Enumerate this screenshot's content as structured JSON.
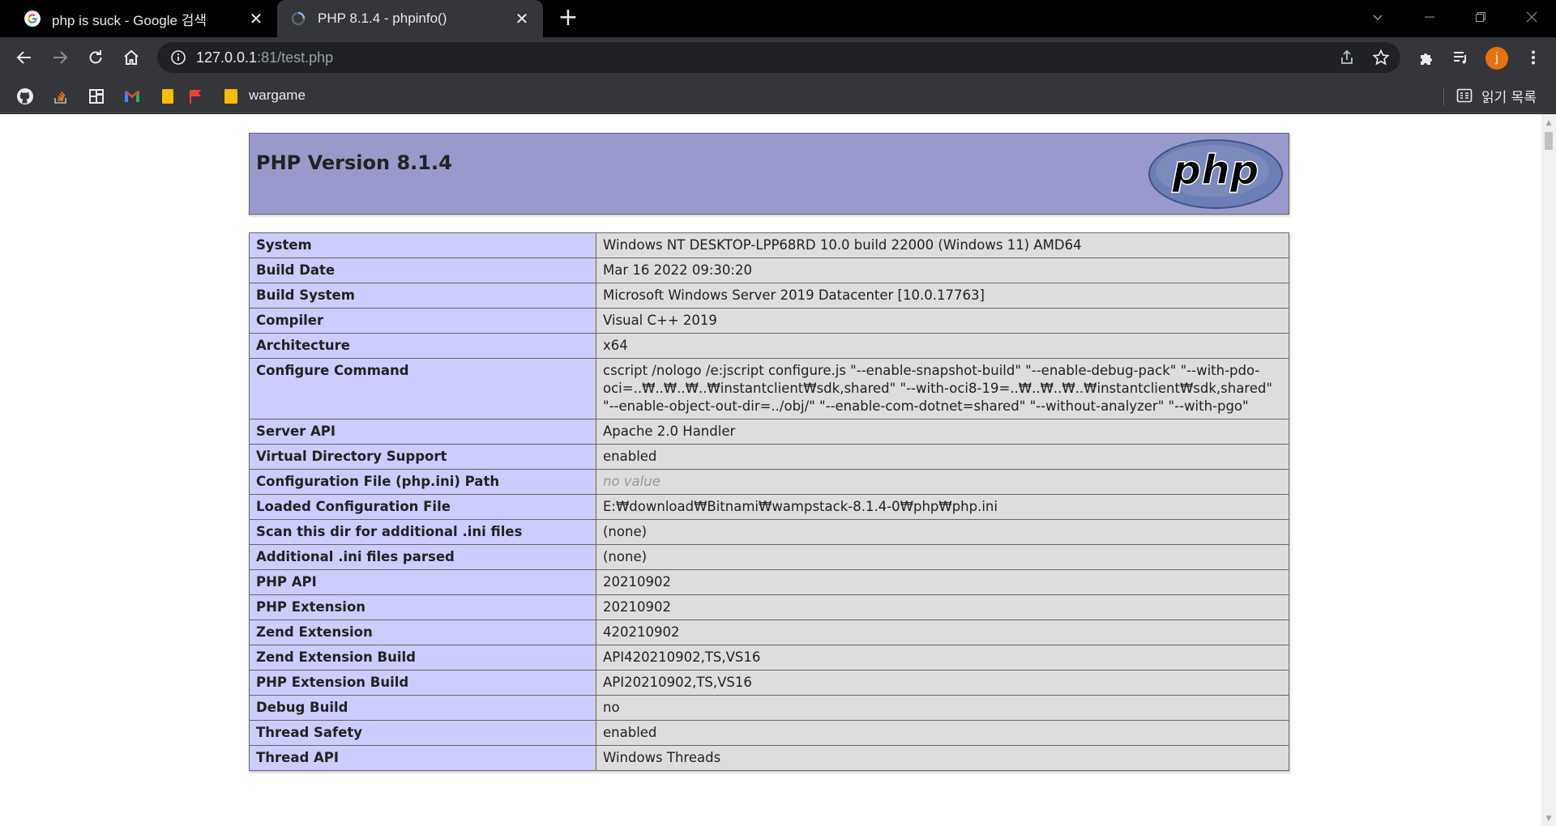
{
  "tabs": [
    {
      "title": "php is suck - Google 검색",
      "icon": "google-icon"
    },
    {
      "title": "PHP 8.1.4 - phpinfo()",
      "icon": "loading-icon"
    }
  ],
  "omnibox": {
    "host": "127.0.0.1",
    "rest": ":81/test.php"
  },
  "profile": {
    "initial": "j"
  },
  "bookmarks": {
    "folder_label": "wargame",
    "reading_list": "읽기 목록"
  },
  "php": {
    "version_title": "PHP Version 8.1.4",
    "logo_text": "php",
    "rows": [
      {
        "key": "System",
        "value": "Windows NT DESKTOP-LPP68RD 10.0 build 22000 (Windows 11) AMD64"
      },
      {
        "key": "Build Date",
        "value": "Mar 16 2022 09:30:20"
      },
      {
        "key": "Build System",
        "value": "Microsoft Windows Server 2019 Datacenter [10.0.17763]"
      },
      {
        "key": "Compiler",
        "value": "Visual C++ 2019"
      },
      {
        "key": "Architecture",
        "value": "x64"
      },
      {
        "key": "Configure Command",
        "value": "cscript /nologo /e:jscript configure.js \"--enable-snapshot-build\" \"--enable-debug-pack\" \"--with-pdo-oci=..₩..₩..₩..₩instantclient₩sdk,shared\" \"--with-oci8-19=..₩..₩..₩..₩instantclient₩sdk,shared\" \"--enable-object-out-dir=../obj/\" \"--enable-com-dotnet=shared\" \"--without-analyzer\" \"--with-pgo\""
      },
      {
        "key": "Server API",
        "value": "Apache 2.0 Handler"
      },
      {
        "key": "Virtual Directory Support",
        "value": "enabled"
      },
      {
        "key": "Configuration File (php.ini) Path",
        "value": "no value",
        "novalue": true
      },
      {
        "key": "Loaded Configuration File",
        "value": "E:₩download₩Bitnami₩wampstack-8.1.4-0₩php₩php.ini"
      },
      {
        "key": "Scan this dir for additional .ini files",
        "value": "(none)"
      },
      {
        "key": "Additional .ini files parsed",
        "value": "(none)"
      },
      {
        "key": "PHP API",
        "value": "20210902"
      },
      {
        "key": "PHP Extension",
        "value": "20210902"
      },
      {
        "key": "Zend Extension",
        "value": "420210902"
      },
      {
        "key": "Zend Extension Build",
        "value": "API420210902,TS,VS16"
      },
      {
        "key": "PHP Extension Build",
        "value": "API20210902,TS,VS16"
      },
      {
        "key": "Debug Build",
        "value": "no"
      },
      {
        "key": "Thread Safety",
        "value": "enabled"
      },
      {
        "key": "Thread API",
        "value": "Windows Threads"
      }
    ]
  }
}
